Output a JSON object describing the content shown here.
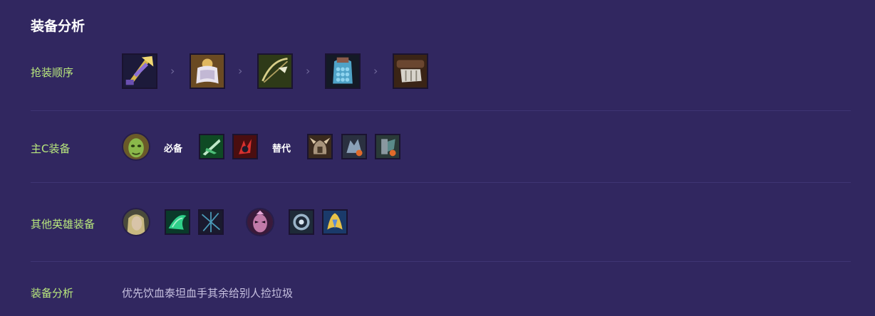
{
  "section_title": "装备分析",
  "rows": {
    "build_order_label": "抢装顺序",
    "main_c_label": "主C装备",
    "others_label": "其他英雄装备",
    "analysis_label": "装备分析"
  },
  "build_order": {
    "separator": "›",
    "items": [
      {
        "icon": "golden-spear-item-icon"
      },
      {
        "icon": "white-cloak-item-icon"
      },
      {
        "icon": "bow-item-icon"
      },
      {
        "icon": "chain-vest-item-icon"
      },
      {
        "icon": "gauntlet-item-icon"
      }
    ]
  },
  "main_c": {
    "champion_icon": "green-champion-portrait-icon",
    "required_label": "必备",
    "required_items": [
      {
        "icon": "green-blade-item-icon"
      },
      {
        "icon": "red-claw-item-icon"
      }
    ],
    "alternative_label": "替代",
    "alternative_items": [
      {
        "icon": "horned-helm-item-icon"
      },
      {
        "icon": "spiked-armor-item-icon"
      },
      {
        "icon": "battle-gear-item-icon"
      }
    ]
  },
  "others": [
    {
      "champion_icon": "blonde-champion-portrait-icon",
      "items": [
        {
          "icon": "green-wing-item-icon"
        },
        {
          "icon": "dark-web-item-icon"
        }
      ]
    },
    {
      "champion_icon": "masked-champion-portrait-icon",
      "items": [
        {
          "icon": "silver-orb-item-icon"
        },
        {
          "icon": "golden-crest-item-icon"
        }
      ]
    }
  ],
  "analysis": {
    "text": "优先饮血泰坦血手其余给别人捡垃圾"
  }
}
